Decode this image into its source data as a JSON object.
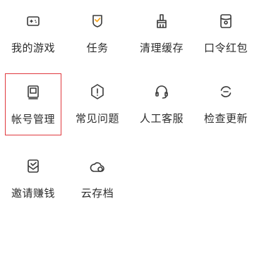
{
  "menu": {
    "items": [
      {
        "label": "我的游戏",
        "icon": "gamepad-icon"
      },
      {
        "label": "任务",
        "icon": "task-shield-icon",
        "accent": "#f5a623"
      },
      {
        "label": "清理缓存",
        "icon": "brush-icon"
      },
      {
        "label": "口令红包",
        "icon": "red-packet-icon"
      },
      {
        "label": "帐号管理",
        "icon": "account-book-icon",
        "selected": true,
        "selected_border": "#e0393e"
      },
      {
        "label": "常见问题",
        "icon": "faq-hexagon-icon"
      },
      {
        "label": "人工客服",
        "icon": "headset-icon"
      },
      {
        "label": "检查更新",
        "icon": "update-refresh-icon"
      },
      {
        "label": "邀请赚钱",
        "icon": "invite-envelope-icon"
      },
      {
        "label": "云存档",
        "icon": "cloud-icon"
      }
    ]
  }
}
